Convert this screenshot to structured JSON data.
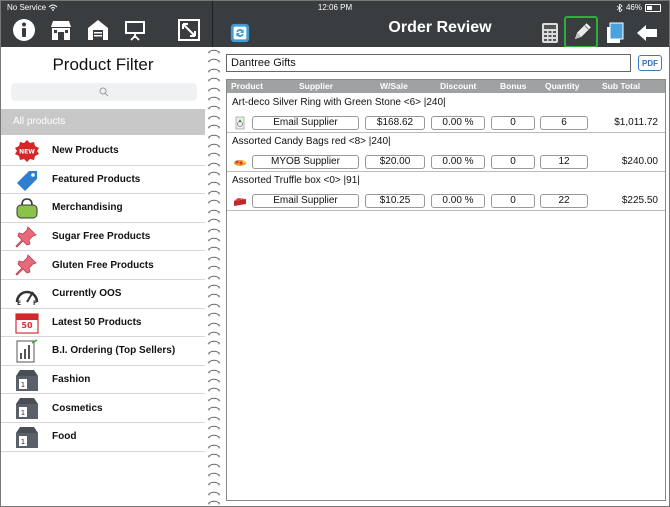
{
  "status": {
    "carrier": "No Service",
    "time": "12:06 PM",
    "battery": "46%"
  },
  "header": {
    "title": "Order Review"
  },
  "product_filter": {
    "title": "Product Filter",
    "search_placeholder": "",
    "all_label": "All products",
    "categories": [
      {
        "label": "New Products",
        "icon": "new-badge-icon"
      },
      {
        "label": "Featured Products",
        "icon": "tag-icon"
      },
      {
        "label": "Merchandising",
        "icon": "bag-icon"
      },
      {
        "label": "Sugar Free Products",
        "icon": "pushpin-icon"
      },
      {
        "label": "Gluten Free Products",
        "icon": "pushpin-icon"
      },
      {
        "label": "Currently OOS",
        "icon": "gauge-icon"
      },
      {
        "label": "Latest 50 Products",
        "icon": "calendar-icon"
      },
      {
        "label": "B.I. Ordering (Top Sellers)",
        "icon": "chart-report-icon"
      },
      {
        "label": "Fashion",
        "icon": "box-icon"
      },
      {
        "label": "Cosmetics",
        "icon": "box-icon"
      },
      {
        "label": "Food",
        "icon": "box-icon"
      }
    ]
  },
  "order": {
    "customer": "Dantree Gifts",
    "pdf_label": "PDF",
    "columns": [
      "Product",
      "Supplier",
      "W/Sale",
      "Discount",
      "Bonus",
      "Quantity",
      "Sub Total"
    ],
    "rows": [
      {
        "name": "Art-deco Silver Ring with Green Stone <6> |240|",
        "supplier": "Email Supplier",
        "wsale": "$168.62",
        "discount": "0.00 %",
        "bonus": "0",
        "quantity": "6",
        "subtotal": "$1,011.72",
        "icon": "ring-product-icon"
      },
      {
        "name": "Assorted Candy Bags red <8> |240|",
        "supplier": "MYOB Supplier",
        "wsale": "$20.00",
        "discount": "0.00 %",
        "bonus": "0",
        "quantity": "12",
        "subtotal": "$240.00",
        "icon": "candy-product-icon"
      },
      {
        "name": "Assorted Truffle box <0> |91|",
        "supplier": "Email Supplier",
        "wsale": "$10.25",
        "discount": "0.00 %",
        "bonus": "0",
        "quantity": "22",
        "subtotal": "$225.50",
        "icon": "truffle-product-icon"
      }
    ]
  },
  "colors": {
    "toolbar": "#3a3d40",
    "highlight": "#2fae3a",
    "pdf_blue": "#2e6fc4",
    "header_gray": "#9fa1a3"
  }
}
